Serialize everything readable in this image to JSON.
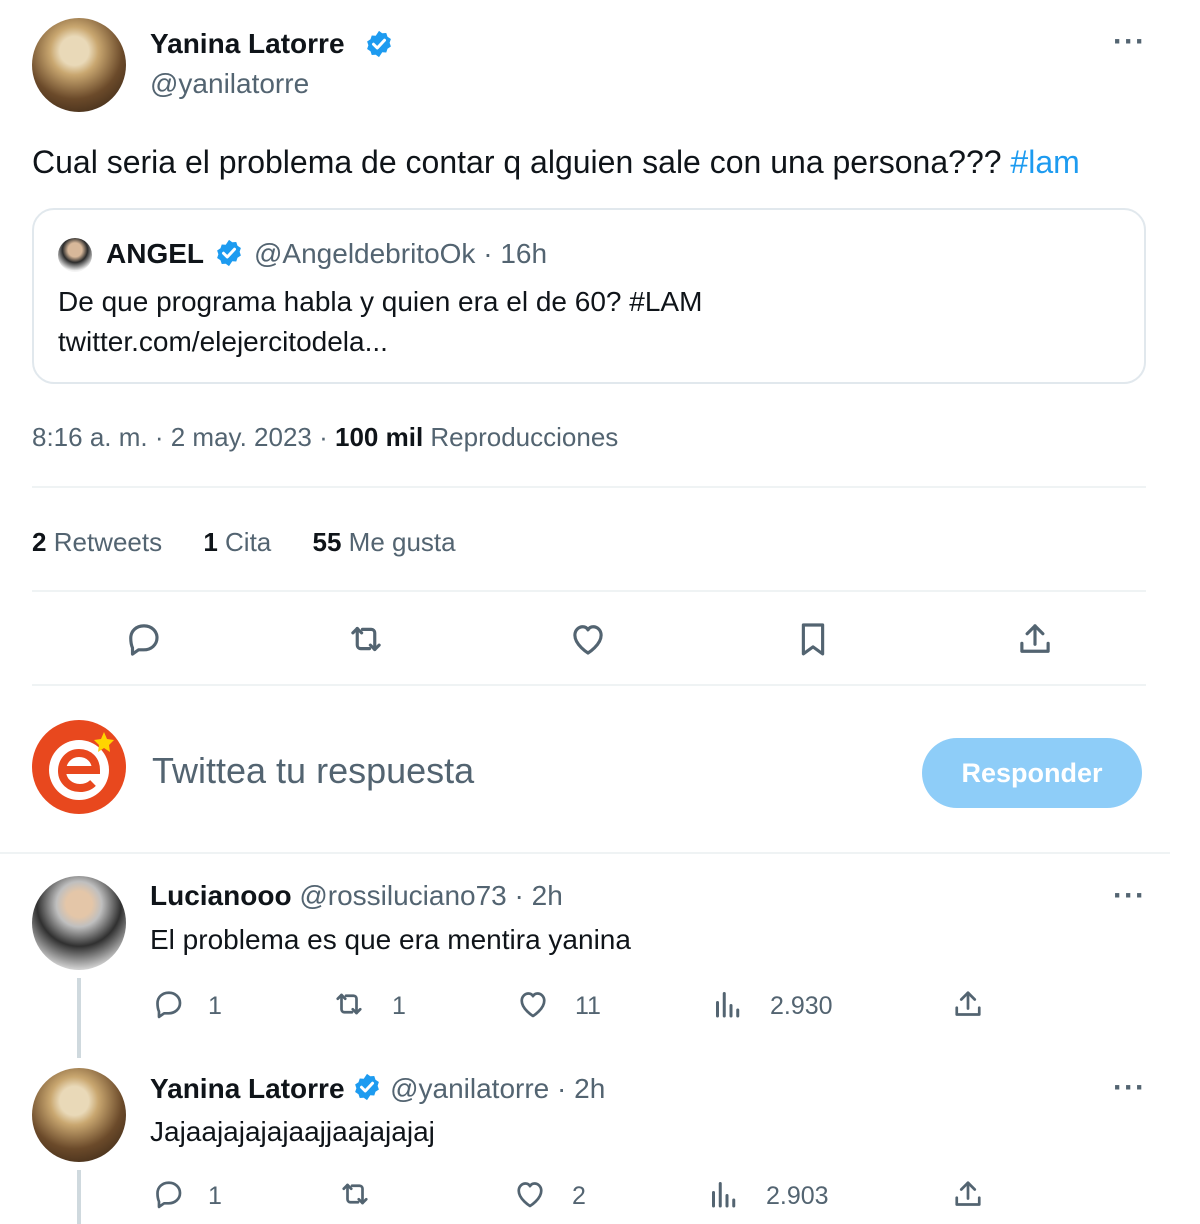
{
  "main_tweet": {
    "author_name": "Yanina Latorre",
    "author_handle": "@yanilatorre",
    "text_before_tag": "Cual seria el problema de contar q alguien sale con una persona???",
    "hashtag": "#lam",
    "quoted": {
      "author_name": "ANGEL",
      "author_handle": "@AngeldebritoOk",
      "separator": "·",
      "time": "16h",
      "text_line1": "De que programa habla y quien era el de 60? #LAM",
      "text_line2": "twitter.com/elejercitodela..."
    },
    "timestamp": "8:16 a. m. · 2 may. 2023 ·",
    "views_count": "100 mil",
    "views_label": "Reproducciones",
    "stats": {
      "retweets_count": "2",
      "retweets_label": "Retweets",
      "quotes_count": "1",
      "quotes_label": "Cita",
      "likes_count": "55",
      "likes_label": "Me gusta"
    }
  },
  "composer": {
    "placeholder": "Twittea tu respuesta",
    "button_label": "Responder"
  },
  "replies": [
    {
      "author_name": "Lucianooo",
      "author_handle": "@rossiluciano73",
      "meta": "· 2h",
      "text": "El problema es que era mentira yanina",
      "replies": "1",
      "retweets": "1",
      "likes": "11",
      "views": "2.930"
    },
    {
      "author_name": "Yanina Latorre",
      "author_handle": "@yanilatorre",
      "meta": "· 2h",
      "text": "Jajaajajajajaajjaajajajaj",
      "replies": "1",
      "retweets": "",
      "likes": "2",
      "views": "2.903"
    }
  ],
  "colors": {
    "accent": "#1d9bf0",
    "button_disabled": "#8ecdf8",
    "text_secondary": "#536471",
    "divider": "#eff3f4"
  }
}
